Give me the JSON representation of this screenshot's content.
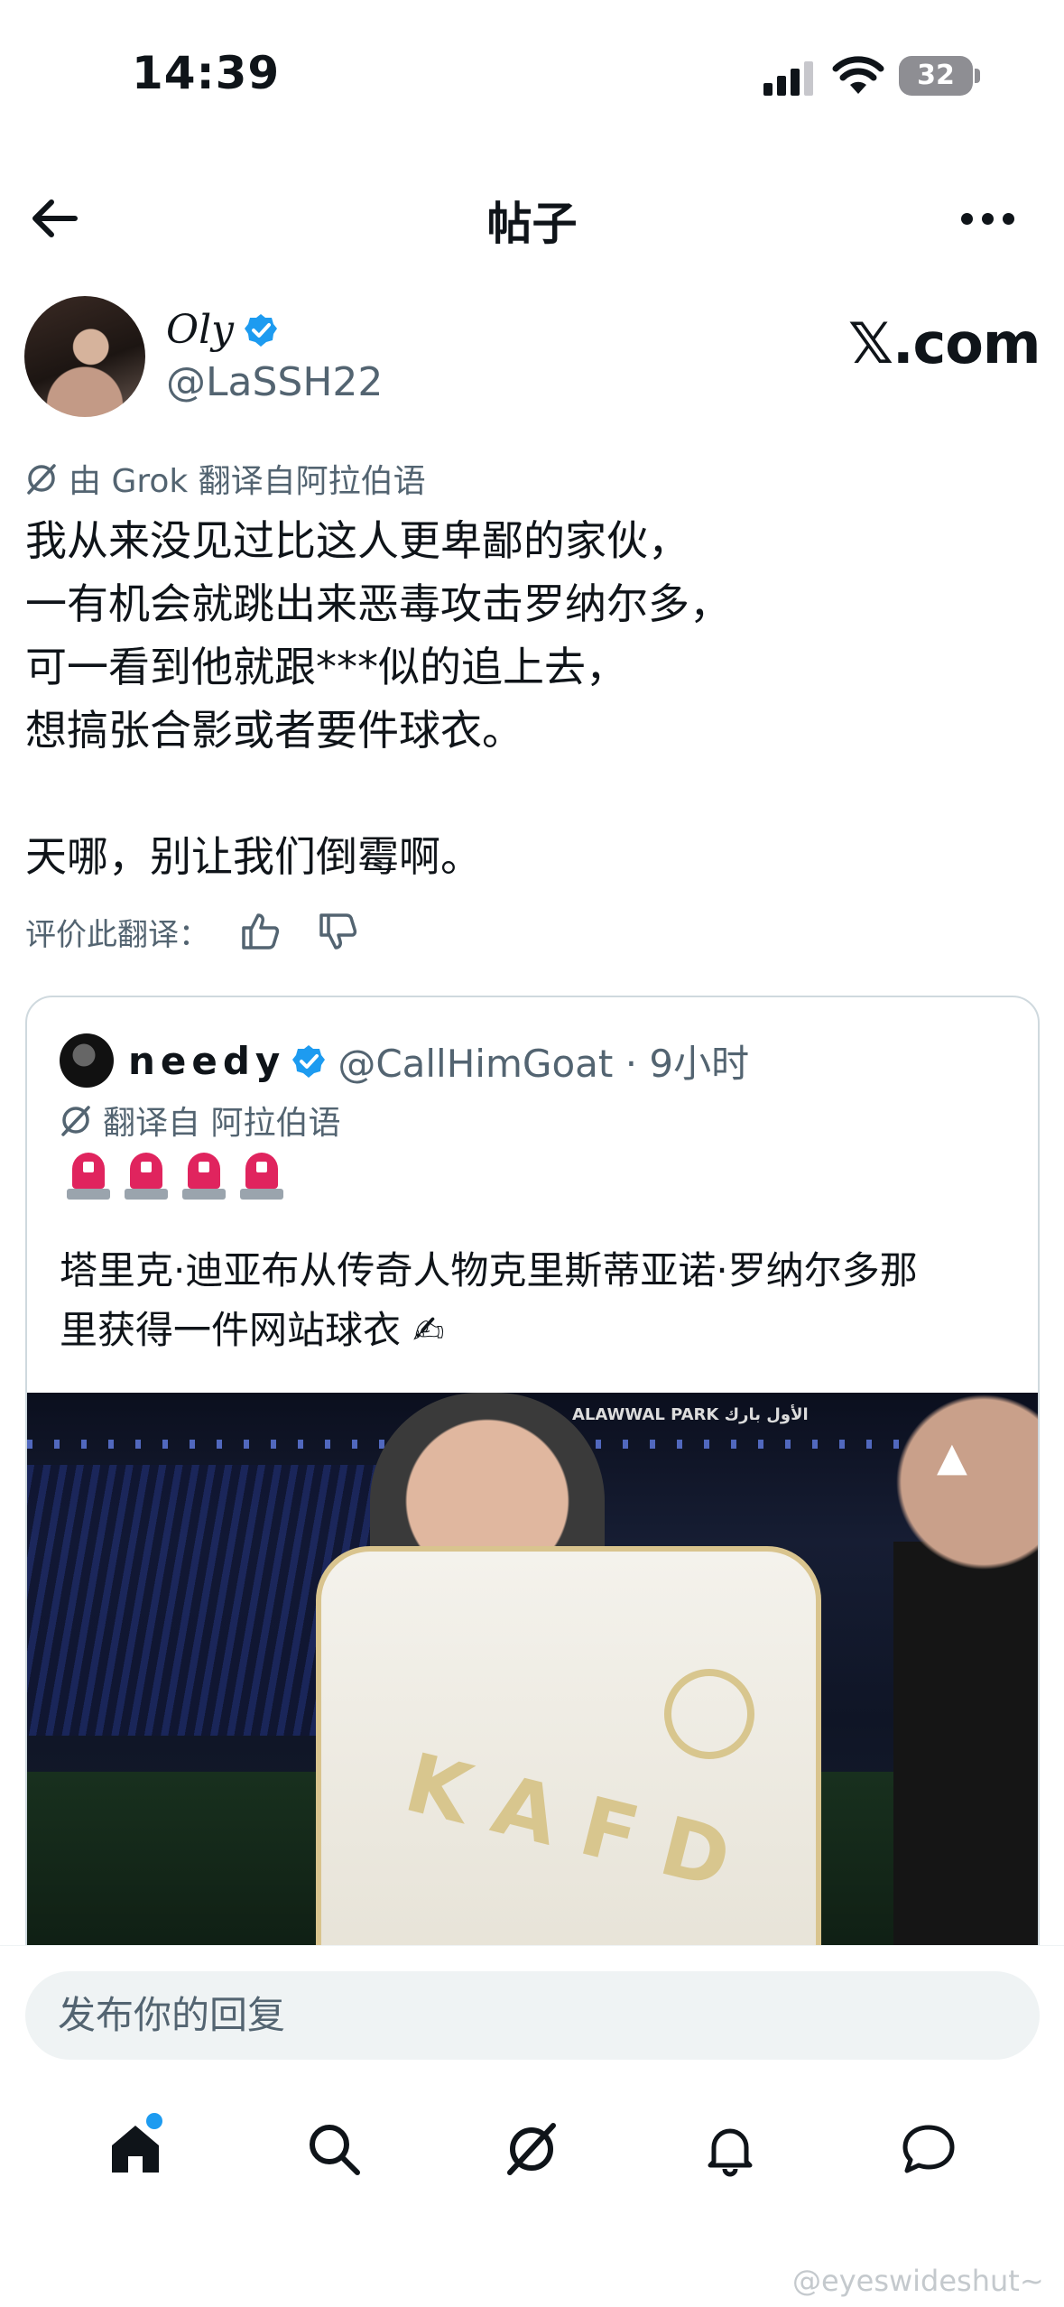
{
  "status_bar": {
    "time": "14:39",
    "battery": "32"
  },
  "header": {
    "title": "帖子"
  },
  "author": {
    "name": "Oly",
    "handle": "@LaSSH22",
    "source_logo": "𝕏.com"
  },
  "post": {
    "translation_label": "由 Grok 翻译自阿拉伯语",
    "text": "我从来没见过比这人更卑鄙的家伙，\n一有机会就跳出来恶毒攻击罗纳尔多，\n可一看到他就跟***似的追上去，\n想搞张合影或者要件球衣。\n\n天哪，别让我们倒霉啊。",
    "rate_label": "评价此翻译："
  },
  "quote": {
    "name": "needy",
    "handle_time": "@CallHimGoat · 9小时",
    "translation_label": "翻译自 阿拉伯语",
    "siren_count": 4,
    "text": "塔里克·迪亚布从传奇人物克里斯蒂亚诺·罗纳尔多那\n里获得一件网站球衣 ✍",
    "image_caption": "ALAWWAL PARK  الأول بارك",
    "jersey_text": "KAFD"
  },
  "reply": {
    "placeholder": "发布你的回复"
  },
  "watermark": "@eyeswideshut~",
  "colors": {
    "accent": "#1d9bf0",
    "secondary_text": "#536471"
  },
  "nav": {
    "items": [
      "home-icon",
      "search-icon",
      "grok-icon",
      "bell-icon",
      "messages-icon"
    ],
    "home_has_notification": true
  }
}
